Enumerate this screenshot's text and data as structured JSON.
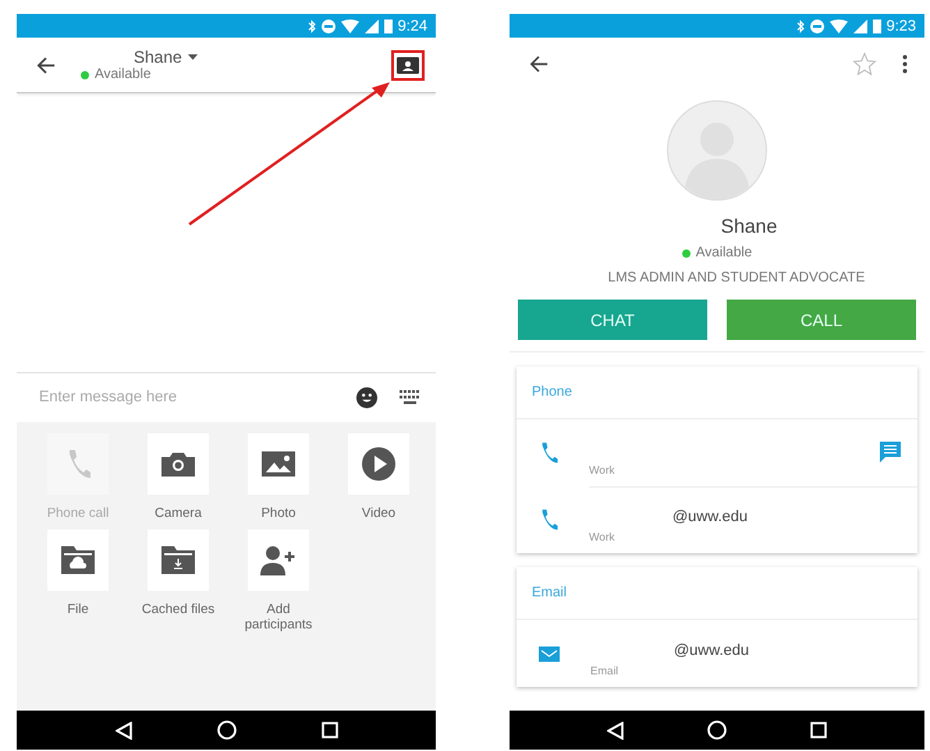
{
  "left_screen": {
    "status_bar": {
      "time": "9:24"
    },
    "header": {
      "name": "Shane",
      "presence": "Available"
    },
    "annotation": {
      "highlight_on": true
    },
    "composer": {
      "placeholder": "Enter message here"
    },
    "attachments": [
      {
        "kind": "phone",
        "label": "Phone call",
        "disabled": true
      },
      {
        "kind": "camera",
        "label": "Camera",
        "disabled": false
      },
      {
        "kind": "photo",
        "label": "Photo",
        "disabled": false
      },
      {
        "kind": "video",
        "label": "Video",
        "disabled": false
      },
      {
        "kind": "file",
        "label": "File",
        "disabled": false
      },
      {
        "kind": "cached",
        "label": "Cached files",
        "disabled": false
      },
      {
        "kind": "add-person",
        "label": "Add participants",
        "disabled": false
      }
    ]
  },
  "right_screen": {
    "status_bar": {
      "time": "9:23"
    },
    "toolbar": {
      "starred": false
    },
    "profile": {
      "name": "Shane",
      "presence": "Available",
      "title": "LMS ADMIN AND STUDENT ADVOCATE"
    },
    "actions": [
      {
        "kind": "chat",
        "label": "CHAT"
      },
      {
        "kind": "call",
        "label": "CALL"
      }
    ],
    "sections": [
      {
        "kind": "phone",
        "heading": "Phone",
        "entries": [
          {
            "label": "Work",
            "message_action": true
          },
          {
            "value": "@uww.edu",
            "label": "Work",
            "message_action": false
          }
        ]
      },
      {
        "kind": "email",
        "heading": "Email",
        "entries": [
          {
            "value": "@uww.edu",
            "label": "Email",
            "message_action": false
          }
        ]
      }
    ]
  }
}
